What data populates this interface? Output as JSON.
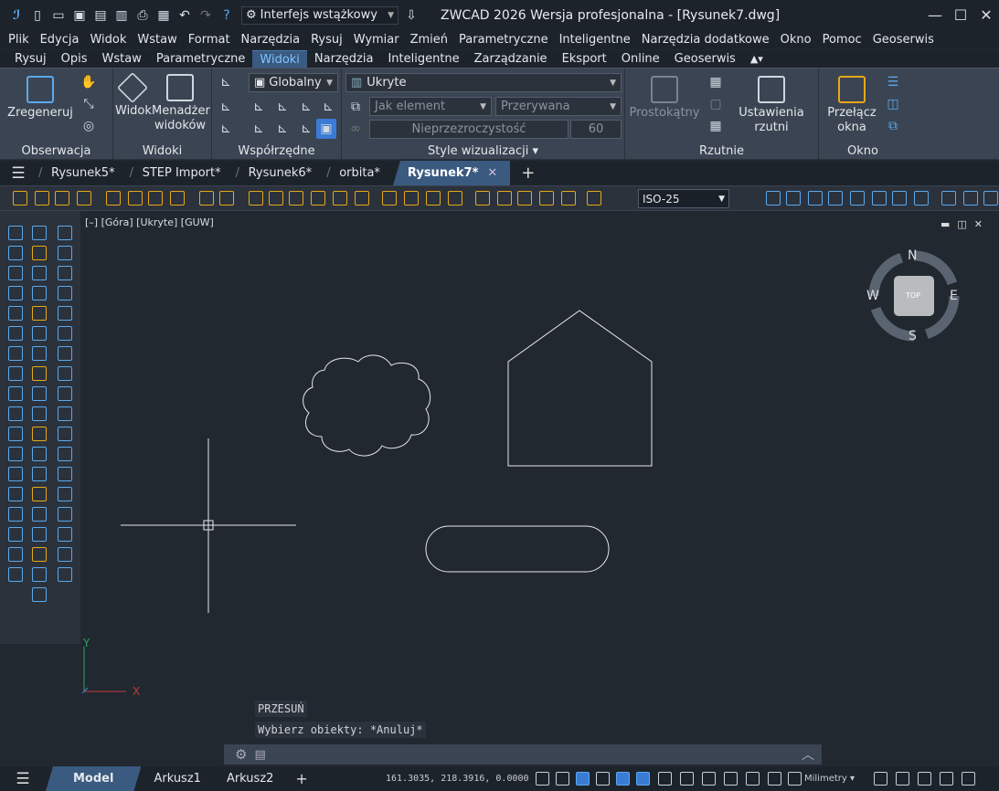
{
  "window": {
    "title": "ZWCAD 2026 Wersja profesjonalna - [Rysunek7.dwg]"
  },
  "quickaccess": {
    "workspace": "Interfejs wstążkowy"
  },
  "menu": [
    "Plik",
    "Edycja",
    "Widok",
    "Wstaw",
    "Format",
    "Narzędzia",
    "Rysuj",
    "Wymiar",
    "Zmień",
    "Parametryczne",
    "Inteligentne",
    "Narzędzia dodatkowe",
    "Okno",
    "Pomoc",
    "Geoserwis"
  ],
  "ribbon_tabs": [
    "Rysuj",
    "Opis",
    "Wstaw",
    "Parametryczne",
    "Widoki",
    "Narzędzia",
    "Inteligentne",
    "Zarządzanie",
    "Eksport",
    "Online",
    "Geoserwis"
  ],
  "ribbon": {
    "observation": {
      "label": "Obserwacja",
      "regen": "Zregeneruj"
    },
    "views": {
      "label": "Widoki",
      "view": "Widok",
      "manager_line1": "Menadżer",
      "manager_line2": "widoków"
    },
    "coords": {
      "label": "Współrzędne",
      "ucs": "Globalny"
    },
    "visual": {
      "label": "Style wizualizacji",
      "style": "Ukryte",
      "element": "Jak element",
      "linetype": "Przerywana",
      "transparency": "Nieprzezroczystość",
      "transparency_value": "60"
    },
    "viewports": {
      "label": "Rzutnie",
      "rect": "Prostokątny",
      "settings": "Ustawienia rzutni"
    },
    "window": {
      "label": "Okno",
      "switch_line1": "Przełącz",
      "switch_line2": "okna"
    }
  },
  "doc_tabs": [
    "Rysunek5*",
    "STEP Import*",
    "Rysunek6*",
    "orbita*",
    "Rysunek7*"
  ],
  "active_doc": "Rysunek7*",
  "toolbar": {
    "dimstyle": "ISO-25"
  },
  "viewport": {
    "label": "[–] [Góra] [Ukryte] [GUW]",
    "viewcube": {
      "top": "TOP",
      "n": "N",
      "s": "S",
      "e": "E",
      "w": "W"
    },
    "ucs_x": "X",
    "ucs_y": "Y"
  },
  "command": {
    "line1": "PRZESUŃ",
    "line2": "Wybierz obiekty: *Anuluj*"
  },
  "status": {
    "tabs": [
      "Model",
      "Arkusz1",
      "Arkusz2"
    ],
    "coords": "161.3035, 218.3916, 0.0000",
    "units": "Milimetry"
  }
}
